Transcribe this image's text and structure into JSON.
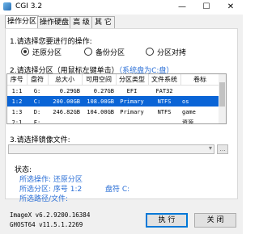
{
  "window": {
    "title": "CGI 3.2",
    "minimize": "—",
    "maximize": "☐",
    "close": "✕"
  },
  "tabs": [
    "操作分区",
    "操作硬盘",
    "高 级",
    "其 它"
  ],
  "operation": {
    "label": "1.请选择您要进行的操作:",
    "options": [
      "还原分区",
      "备份分区",
      "分区对拷"
    ],
    "selected_index": 0
  },
  "partition": {
    "label": "2.请选择分区（用鼠标左键单击）",
    "hint": "（系统盘为C:盘）",
    "columns": [
      "序号",
      "盘符",
      "总大小",
      "可用空间",
      "分区类型",
      "文件系统",
      "卷标"
    ],
    "rows": [
      [
        "1:1",
        "G:",
        "0.29GB",
        "0.27GB",
        "EFI",
        "FAT32",
        ""
      ],
      [
        "1:2",
        "C:",
        "200.00GB",
        "108.00GB",
        "Primary",
        "NTFS",
        "os"
      ],
      [
        "1:3",
        "D:",
        "246.82GB",
        "104.00GB",
        "Primary",
        "NTFS",
        "game"
      ],
      [
        "2:1",
        "F:",
        "",
        "",
        "",
        "",
        "资源"
      ]
    ],
    "selected_row": 1
  },
  "image_file": {
    "label": "3.请选择镜像文件:",
    "value": "",
    "browse": "..."
  },
  "status": {
    "label": "状态:",
    "operation": "所选操作: 还原分区",
    "partition": "所选分区:  序号 1:2",
    "drive": "盘符 C:",
    "path": "所选路径/文件:"
  },
  "footer": {
    "imagex": "ImageX v6.2.9200.16384",
    "ghost": "GHOST64 v11.5.1.2269"
  },
  "buttons": {
    "execute": "执 行",
    "close": "关 闭"
  }
}
